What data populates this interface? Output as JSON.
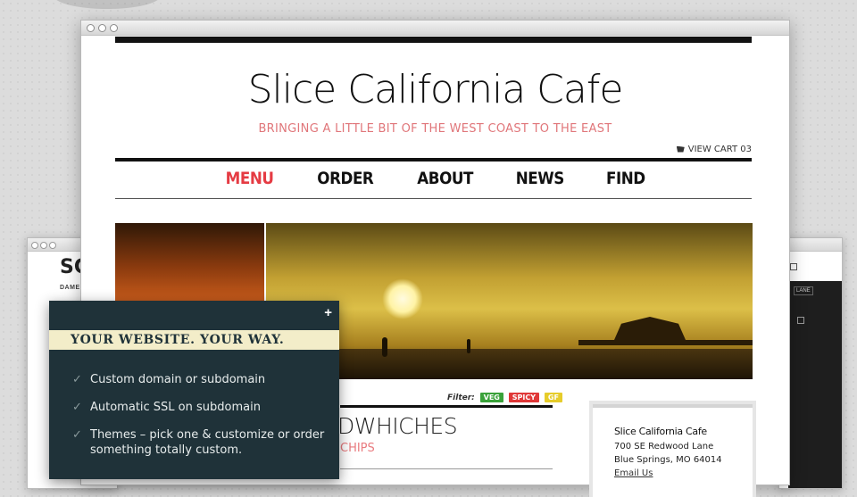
{
  "page": {
    "site_title": "Slice California Cafe",
    "tagline": "BRINGING A LITTLE BIT OF THE WEST COAST TO THE EAST",
    "view_cart_label": "VIEW CART",
    "cart_count": "03",
    "nav": [
      {
        "label": "MENU",
        "active": true
      },
      {
        "label": "ORDER",
        "active": false
      },
      {
        "label": "ABOUT",
        "active": false
      },
      {
        "label": "NEWS",
        "active": false
      },
      {
        "label": "FIND",
        "active": false
      }
    ],
    "filter_label": "Filter:",
    "filter_badges": [
      "VEG",
      "SPICY",
      "GF"
    ],
    "section_heading_partial": "DWHICHES",
    "section_sub_partial": "CHIPS",
    "address": {
      "name": "Slice California Cafe",
      "line1": "700 SE Redwood Lane",
      "line2": "Blue Springs, MO 64014",
      "link": "Email Us"
    }
  },
  "bg_left": {
    "logo_fragment": "SC",
    "sub_fragment": "DAMEI"
  },
  "bg_right": {
    "mini_button": "LANE"
  },
  "panel": {
    "close_symbol": "+",
    "banner": "YOUR WEBSITE. YOUR WAY.",
    "features": [
      "Custom domain or subdomain",
      "Automatic SSL on subdomain",
      "Themes – pick one & customize or order something totally custom."
    ]
  },
  "colors": {
    "accent_red": "#e53b43",
    "tagline_pink": "#e0767a",
    "panel_bg": "#1f3239",
    "banner_bg": "#f3edc9",
    "veg": "#3aa23a",
    "spicy": "#e03838",
    "gf": "#e6cc2a"
  }
}
